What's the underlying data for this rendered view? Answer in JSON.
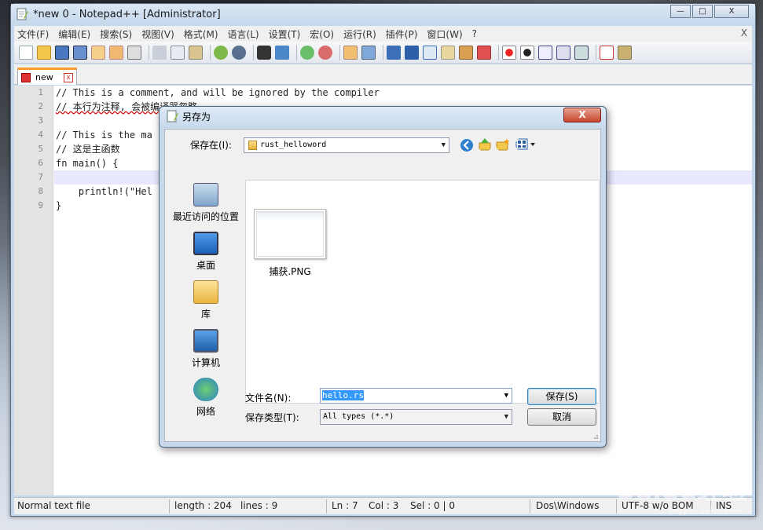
{
  "window": {
    "title": "*new  0 - Notepad++ [Administrator]",
    "min": "—",
    "max": "□",
    "close": "X"
  },
  "menu": [
    "文件(F)",
    "编辑(E)",
    "搜索(S)",
    "视图(V)",
    "格式(M)",
    "语言(L)",
    "设置(T)",
    "宏(O)",
    "运行(R)",
    "插件(P)",
    "窗口(W)",
    "?"
  ],
  "menu_close": "X",
  "tab": {
    "label": "new",
    "close": "x"
  },
  "editor": {
    "line_numbers": [
      "1",
      "2",
      "3",
      "4",
      "5",
      "6",
      "7",
      "8",
      "9"
    ],
    "lines": [
      "// This is a comment, and will be ignored by the compiler",
      "// 本行为注释, 会被编译器忽略",
      "",
      "// This is the ma",
      "// 这是主函数",
      "fn main() {",
      "",
      "    println!(\"Hel",
      "}"
    ]
  },
  "status": {
    "type": "Normal text file",
    "length": "length : 204",
    "lines": "lines : 9",
    "ln": "Ln : 7",
    "col": "Col : 3",
    "sel": "Sel : 0 | 0",
    "eol": "Dos\\Windows",
    "encoding": "UTF-8 w/o BOM",
    "mode": "INS"
  },
  "dialog": {
    "title": "另存为",
    "close": "X",
    "save_in_label": "保存在(I):",
    "save_in_value": "rust_helloword",
    "places": [
      "最近访问的位置",
      "桌面",
      "库",
      "计算机",
      "网络"
    ],
    "files": [
      {
        "name": "捕获.PNG"
      }
    ],
    "filename_label": "文件名(N):",
    "filename_value": "hello.rs",
    "filetype_label": "保存类型(T):",
    "filetype_value": "All types (*.*)",
    "save_button": "保存(S)",
    "cancel_button": "取消"
  },
  "watermark": {
    "text": "Baidu经验",
    "sub": "jingyan.baidu.com"
  },
  "colors": {
    "accent_tab": "#fa9b2e",
    "selection": "#3399ff",
    "current_line": "#e8e8ff"
  },
  "icons": {
    "title": "notepad-icon",
    "folder": "folder-icon",
    "back": "back-arrow-icon",
    "up": "up-folder-icon",
    "newfolder": "new-folder-icon",
    "views": "views-menu-icon"
  }
}
